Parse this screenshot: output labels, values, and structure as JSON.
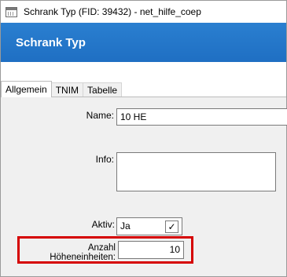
{
  "window": {
    "title": "Schrank Typ (FID: 39432) - net_hilfe_coep"
  },
  "header": {
    "title": "Schrank Typ"
  },
  "tabs": [
    {
      "label": "Allgemein",
      "active": true
    },
    {
      "label": "TNIM",
      "active": false
    },
    {
      "label": "Tabelle",
      "active": false
    }
  ],
  "form": {
    "name": {
      "label": "Name:",
      "value": "10 HE"
    },
    "info": {
      "label": "Info:",
      "value": ""
    },
    "aktiv": {
      "label": "Aktiv:",
      "value": "Ja",
      "icon": "check-icon"
    },
    "hoeheneinheiten": {
      "label": "Anzahl Höheneinheiten:",
      "value": "10"
    }
  },
  "colors": {
    "header": "#1f6fc3",
    "highlight": "#d50000"
  }
}
